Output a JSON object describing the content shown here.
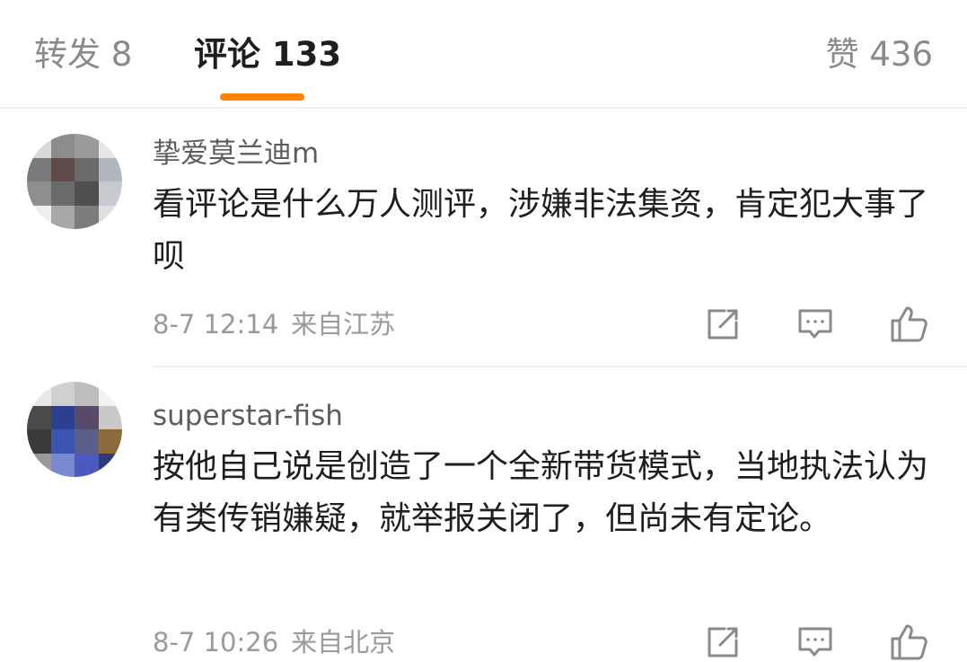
{
  "tabs": {
    "repost": "转发 8",
    "comments": "评论 133",
    "likes": "赞 436",
    "active_color": "#ff8200"
  },
  "comments": [
    {
      "username": "挚爱莫兰迪m",
      "text": "看评论是什么万人测评，涉嫌非法集资，肯定犯大事了呗",
      "date": "8-7 12:14",
      "location": "来自江苏",
      "avatar_colors": [
        "#d9d9d9",
        "#8c8c8c",
        "#9a9a9a",
        "#e6e6e6",
        "#7a7a7a",
        "#5f4b47",
        "#6a6a6a",
        "#b0b8be",
        "#8e8e8e",
        "#6b6b6b",
        "#4f4f4f",
        "#c7cbd0",
        "#eeeeee",
        "#a8a8a8",
        "#7c7c7c",
        "#dfdfdf"
      ]
    },
    {
      "username": "superstar-fish",
      "text": "按他自己说是创造了一个全新带货模式，当地执法认为有类传销嫌疑，就举报关闭了，但尚未有定论。",
      "date": "8-7 10:26",
      "location": "来自北京",
      "avatar_colors": [
        "#e8e8e8",
        "#d0d0d0",
        "#bdbdbd",
        "#f2f2f2",
        "#4a4a4a",
        "#2e3f8f",
        "#5a4a6a",
        "#c9c9c9",
        "#3a3a3a",
        "#3b55b0",
        "#5b5f8c",
        "#8c6a3a",
        "#9a9a9a",
        "#7a8ad0",
        "#4a5ac0",
        "#2f3a7a"
      ]
    }
  ],
  "icons": {
    "share": "share-icon",
    "reply": "comment-icon",
    "like": "thumbs-up-icon"
  }
}
